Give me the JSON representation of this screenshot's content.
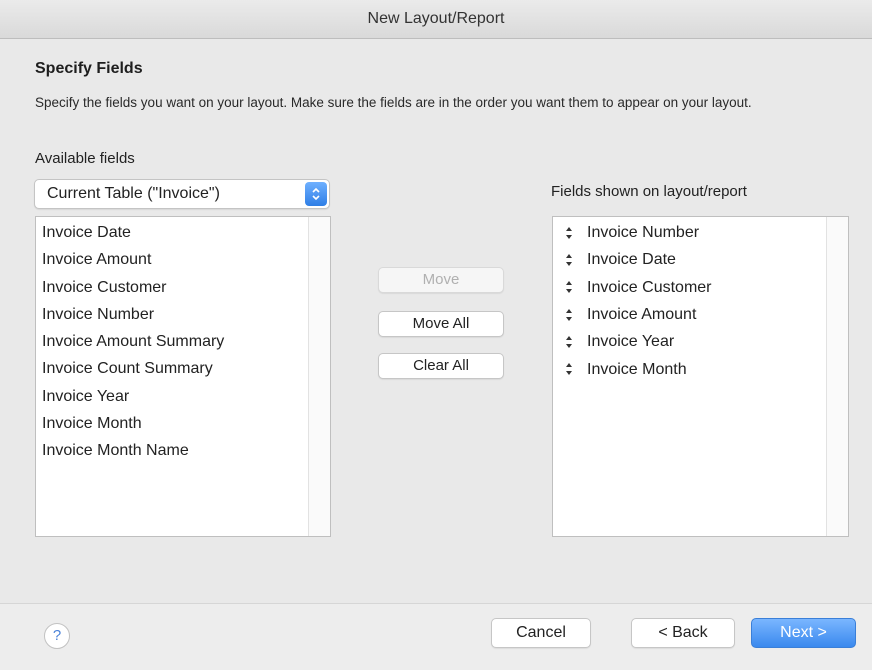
{
  "window": {
    "title": "New Layout/Report"
  },
  "section": {
    "heading": "Specify Fields",
    "description": "Specify the fields you want on your layout. Make sure the fields are in the order you want them to appear on your layout."
  },
  "available": {
    "label": "Available fields",
    "table_select": "Current Table (\"Invoice\")",
    "items": [
      "Invoice Date",
      "Invoice Amount",
      "Invoice Customer",
      "Invoice Number",
      "Invoice Amount Summary",
      "Invoice Count Summary",
      "Invoice Year",
      "Invoice Month",
      "Invoice Month Name"
    ]
  },
  "actions": {
    "move": "Move",
    "move_all": "Move All",
    "clear_all": "Clear All",
    "move_enabled": false
  },
  "shown": {
    "label": "Fields shown on layout/report",
    "items": [
      "Invoice Number",
      "Invoice Date",
      "Invoice Customer",
      "Invoice Amount",
      "Invoice Year",
      "Invoice Month"
    ]
  },
  "footer": {
    "help": "?",
    "cancel": "Cancel",
    "back": "< Back",
    "next": "Next >"
  },
  "colors": {
    "accent": "#3a89ee",
    "disabled_text": "#b0b0b0",
    "window_bg": "#e9e9e9"
  }
}
